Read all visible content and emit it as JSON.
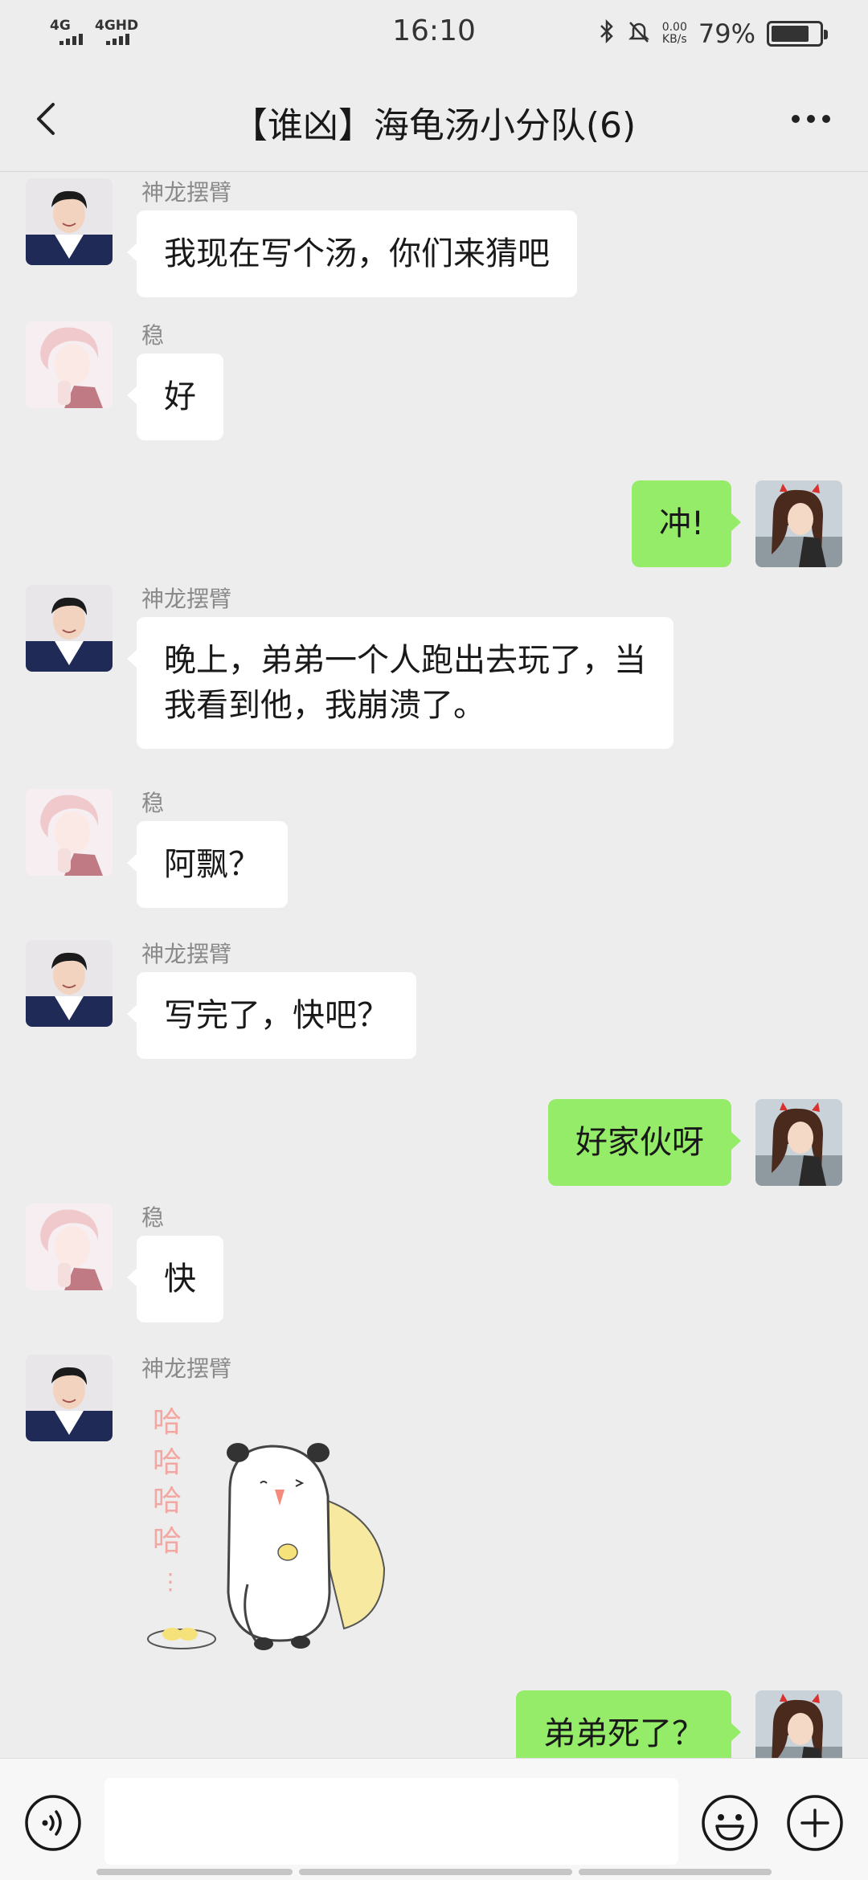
{
  "status_bar": {
    "signal1": "4G",
    "signal2": "4GHD",
    "time": "16:10",
    "speed_value": "0.00",
    "speed_unit": "KB/s",
    "battery_pct": "79%",
    "battery_level": 0.79
  },
  "nav": {
    "title": "【谁凶】海龟汤小分队(6)"
  },
  "messages": [
    {
      "side": "left",
      "sender": "神龙摆臂",
      "text": "我现在写个汤，你们来猜吧"
    },
    {
      "side": "left",
      "sender": "稳",
      "text": "好"
    },
    {
      "side": "right",
      "text": "冲!"
    },
    {
      "side": "left",
      "sender": "神龙摆臂",
      "line1": "晚上，弟弟一个人跑出去玩了，当",
      "line2": "我看到他，我崩溃了。"
    },
    {
      "side": "left",
      "sender": "稳",
      "text": "阿飘？"
    },
    {
      "side": "left",
      "sender": "神龙摆臂",
      "text": "写完了，快吧？"
    },
    {
      "side": "right",
      "text": "好家伙呀"
    },
    {
      "side": "left",
      "sender": "稳",
      "text": "快"
    },
    {
      "side": "left",
      "sender": "神龙摆臂",
      "sticker_chars": [
        "哈",
        "哈",
        "哈",
        "哈",
        "⋮"
      ]
    },
    {
      "side": "right",
      "text": "弟弟死了？"
    }
  ],
  "input_bar": {
    "value": "",
    "icons": [
      "voice-icon",
      "emoji-icon",
      "plus-icon"
    ]
  },
  "colors": {
    "background": "#ededed",
    "bubble_self": "#95ec69",
    "bubble_other": "#ffffff",
    "sender_name": "#8a8a8a"
  }
}
